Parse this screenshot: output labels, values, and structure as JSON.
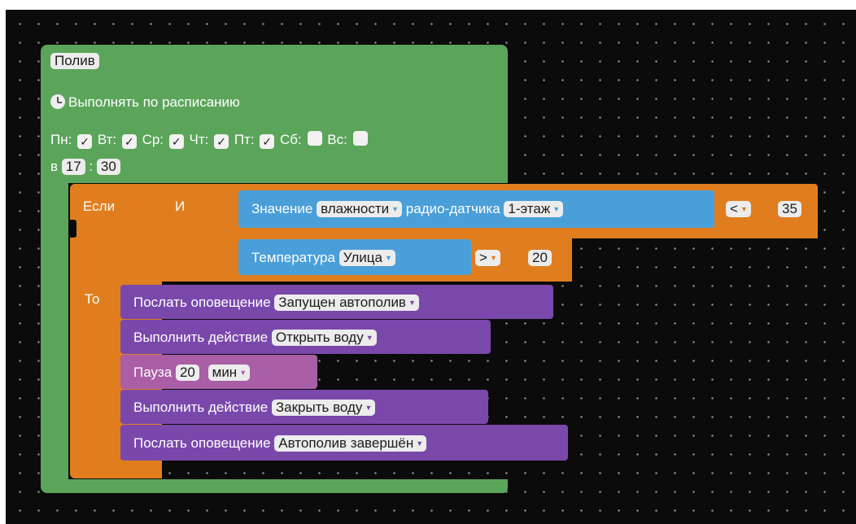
{
  "block": {
    "title": "Полив",
    "schedule_label": "Выполнять по расписанию",
    "days": [
      {
        "label": "Пн:",
        "checked": true
      },
      {
        "label": "Вт:",
        "checked": true
      },
      {
        "label": "Ср:",
        "checked": true
      },
      {
        "label": "Чт:",
        "checked": true
      },
      {
        "label": "Пт:",
        "checked": true
      },
      {
        "label": "Сб:",
        "checked": false
      },
      {
        "label": "Вс:",
        "checked": false
      }
    ],
    "time_prefix": "в",
    "hour": "17",
    "time_sep": ":",
    "minute": "30"
  },
  "check_mark": "✓",
  "dropdown_arrow": "▼",
  "if_block": {
    "if_label": "Если",
    "and_label": "И",
    "then_label": "То"
  },
  "condition1": {
    "value_label": "Значение",
    "measure": "влажности",
    "sensor_label": "радио-датчика",
    "sensor": "1-этаж",
    "operator": "<",
    "threshold": "35"
  },
  "condition2": {
    "temp_label": "Температура",
    "location": "Улица",
    "operator": ">",
    "threshold": "20"
  },
  "actions": {
    "notify1_label": "Послать оповещение",
    "notify1_value": "Запущен автополив",
    "do1_label": "Выполнить действие",
    "do1_value": "Открыть воду",
    "pause_label": "Пауза",
    "pause_value": "20",
    "pause_unit": "мин",
    "do2_label": "Выполнить действие",
    "do2_value": "Закрыть воду",
    "notify2_label": "Послать оповещение",
    "notify2_value": "Автополив завершён"
  },
  "colors": {
    "workspace": "#0b0b0b",
    "event_block": "#5ba55b",
    "logic_block": "#e07e1f",
    "sensor_block": "#4a9fd8",
    "action_block": "#7a48ab",
    "pause_block": "#a95ea6"
  }
}
